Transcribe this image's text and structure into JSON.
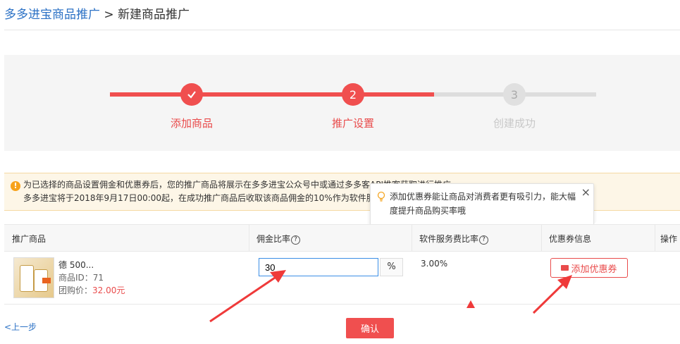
{
  "breadcrumb": {
    "parent": "多多进宝商品推广",
    "separator": " > ",
    "current": "新建商品推广"
  },
  "steps": [
    {
      "number": "1",
      "label": "添加商品",
      "state": "done"
    },
    {
      "number": "2",
      "label": "推广设置",
      "state": "active"
    },
    {
      "number": "3",
      "label": "创建成功",
      "state": "pending"
    }
  ],
  "notice": {
    "line1": "为已选择的商品设置佣金和优惠券后，您的推广商品将展示在多多进宝公众号中或通过多多客API推客获取进行推广",
    "line2": "多多进宝将于2018年9月17日00:00起，在成功推广商品后收取该商品佣金的10%作为软件服务费"
  },
  "tooltip": {
    "text": "添加优惠券能让商品对消费者更有吸引力，能大幅度提升商品购买率哦",
    "close": "×"
  },
  "table": {
    "headers": {
      "product": "推广商品",
      "commission": "佣金比率",
      "service_fee": "软件服务费比率",
      "coupon": "优惠券信息",
      "action": "操作"
    },
    "row": {
      "name": "德          500...",
      "id_label": "商品ID：",
      "id_value": "71",
      "price_label": "团购价：",
      "price_value": "32.00元",
      "commission_value": "30",
      "commission_unit": "%",
      "service_fee": "3.00%",
      "coupon_button": "添加优惠券"
    }
  },
  "footer": {
    "prev": "<上一步",
    "confirm": "确认"
  },
  "colors": {
    "accent": "#f04f4f",
    "link": "#2b71c5",
    "notice_bg": "#fdf6e7"
  }
}
